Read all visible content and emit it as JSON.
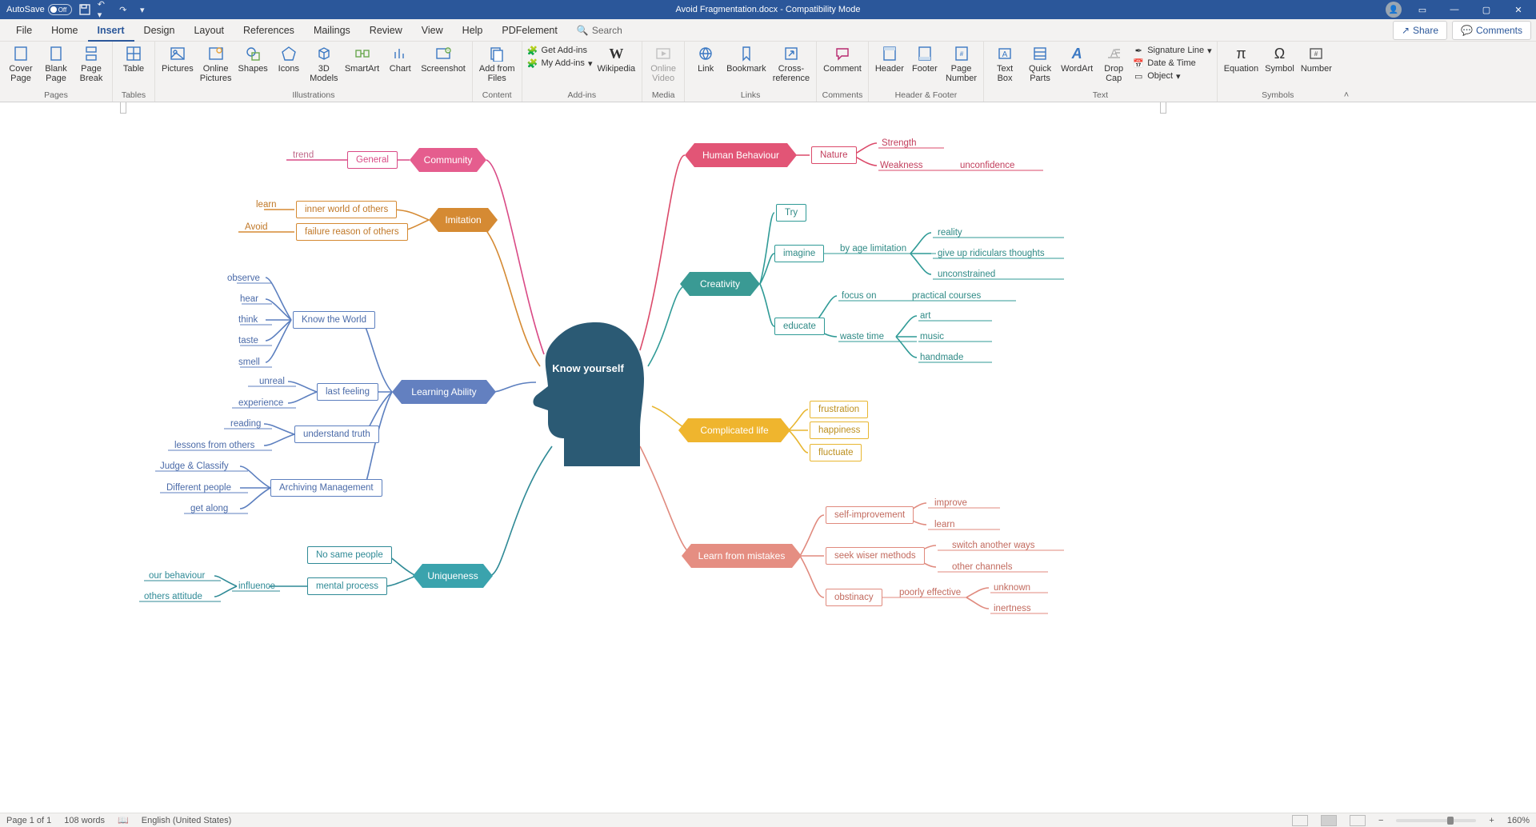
{
  "titlebar": {
    "autosave_label": "AutoSave",
    "autosave_state": "Off",
    "document_title": "Avoid Fragmentation.docx  -  Compatibility Mode"
  },
  "menu": {
    "tabs": [
      "File",
      "Home",
      "Insert",
      "Design",
      "Layout",
      "References",
      "Mailings",
      "Review",
      "View",
      "Help",
      "PDFelement"
    ],
    "active_index": 2,
    "search_placeholder": "Search",
    "share": "Share",
    "comments": "Comments"
  },
  "ribbon": {
    "groups": {
      "pages": {
        "label": "Pages",
        "cover": "Cover\nPage",
        "blank": "Blank\nPage",
        "break": "Page\nBreak"
      },
      "tables": {
        "label": "Tables",
        "table": "Table"
      },
      "illustrations": {
        "label": "Illustrations",
        "pictures": "Pictures",
        "online_pictures": "Online\nPictures",
        "shapes": "Shapes",
        "icons": "Icons",
        "models": "3D\nModels",
        "smartart": "SmartArt",
        "chart": "Chart",
        "screenshot": "Screenshot"
      },
      "content": {
        "label": "Content",
        "addfrom": "Add from\nFiles"
      },
      "addins": {
        "label": "Add-ins",
        "get": "Get Add-ins",
        "my": "My Add-ins",
        "wiki": "Wikipedia"
      },
      "media": {
        "label": "Media",
        "video": "Online\nVideo"
      },
      "links": {
        "label": "Links",
        "link": "Link",
        "bookmark": "Bookmark",
        "crossref": "Cross-\nreference"
      },
      "comments": {
        "label": "Comments",
        "comment": "Comment"
      },
      "headerfooter": {
        "label": "Header & Footer",
        "header": "Header",
        "footer": "Footer",
        "pagenum": "Page\nNumber"
      },
      "text": {
        "label": "Text",
        "textbox": "Text\nBox",
        "quick": "Quick\nParts",
        "wordart": "WordArt",
        "dropcap": "Drop\nCap",
        "sig": "Signature Line",
        "date": "Date & Time",
        "object": "Object"
      },
      "symbols": {
        "label": "Symbols",
        "equation": "Equation",
        "symbol": "Symbol",
        "number": "Number"
      }
    }
  },
  "mindmap": {
    "center": "Know yourself",
    "community": {
      "title": "Community",
      "general": "General",
      "trend": "trend"
    },
    "imitation": {
      "title": "Imitation",
      "inner": "inner world of others",
      "failure": "failure reason of others",
      "learn": "learn",
      "avoid": "Avoid"
    },
    "learning": {
      "title": "Learning Ability",
      "know_world": "Know the World",
      "kw": [
        "observe",
        "hear",
        "think",
        "taste",
        "smell"
      ],
      "last_feeling": "last feeling",
      "lf": [
        "unreal",
        "experience"
      ],
      "understand": "understand truth",
      "ut": [
        "reading",
        "lessons from others"
      ],
      "archiving": "Archiving Management",
      "am": [
        "Judge & Classify",
        "Different people",
        "get along"
      ]
    },
    "uniqueness": {
      "title": "Uniqueness",
      "nosame": "No same people",
      "mental": "mental process",
      "influence": "influence",
      "ours": "our behaviour",
      "others": "others attitude"
    },
    "human": {
      "title": "Human Behaviour",
      "nature": "Nature",
      "strength": "Strength",
      "weakness": "Weakness",
      "unconf": "unconfidence"
    },
    "creativity": {
      "title": "Creativity",
      "try": "Try",
      "imagine": "imagine",
      "byage": "by age limitation",
      "imagine_leaves": [
        "reality",
        "give up ridiculars thoughts",
        "unconstrained"
      ],
      "educate": "educate",
      "focus": "focus on",
      "waste": "waste time",
      "focus_leaf": "practical courses",
      "waste_leaves": [
        "art",
        "music",
        "handmade"
      ]
    },
    "complicated": {
      "title": "Complicated life",
      "items": [
        "frustration",
        "happiness",
        "fluctuate"
      ]
    },
    "learn_mistakes": {
      "title": "Learn from mistakes",
      "selfimp": "self-improvement",
      "selfimp_leaves": [
        "improve",
        "learn"
      ],
      "seek": "seek wiser methods",
      "seek_leaves": [
        "switch another ways",
        "other channels"
      ],
      "obstinacy": "obstinacy",
      "poorly": "poorly  effective",
      "poor_leaves": [
        "unknown",
        "inertness"
      ]
    }
  },
  "statusbar": {
    "page": "Page 1 of 1",
    "words": "108 words",
    "lang": "English (United States)",
    "zoom": "160%"
  }
}
